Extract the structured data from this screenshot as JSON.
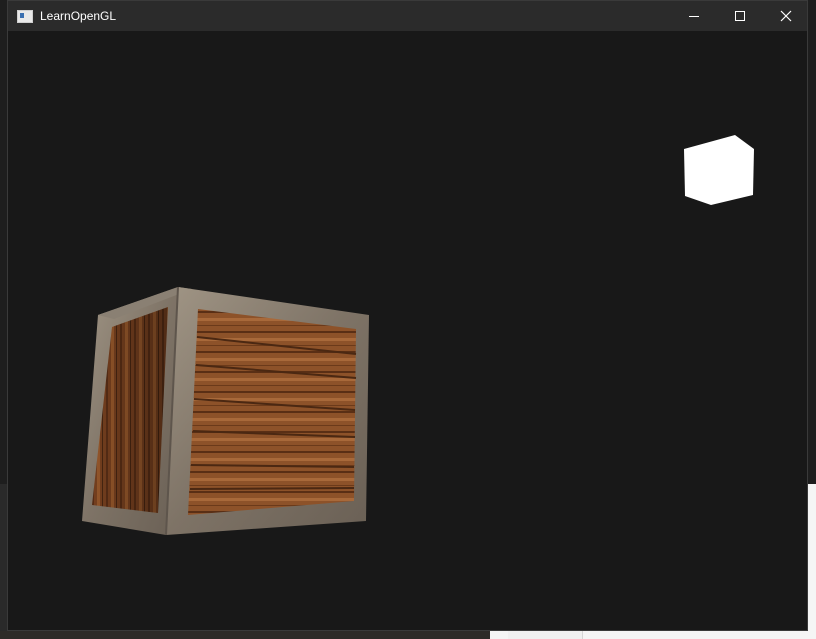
{
  "window": {
    "title": "LearnOpenGL",
    "buttons": {
      "minimize": "minimize",
      "maximize": "maximize",
      "close": "close"
    }
  },
  "scene": {
    "background_color": "#181818",
    "light_cube_color": "#ffffff",
    "crate_wood_color": "#8a4e26",
    "crate_frame_color": "#8f8478"
  }
}
